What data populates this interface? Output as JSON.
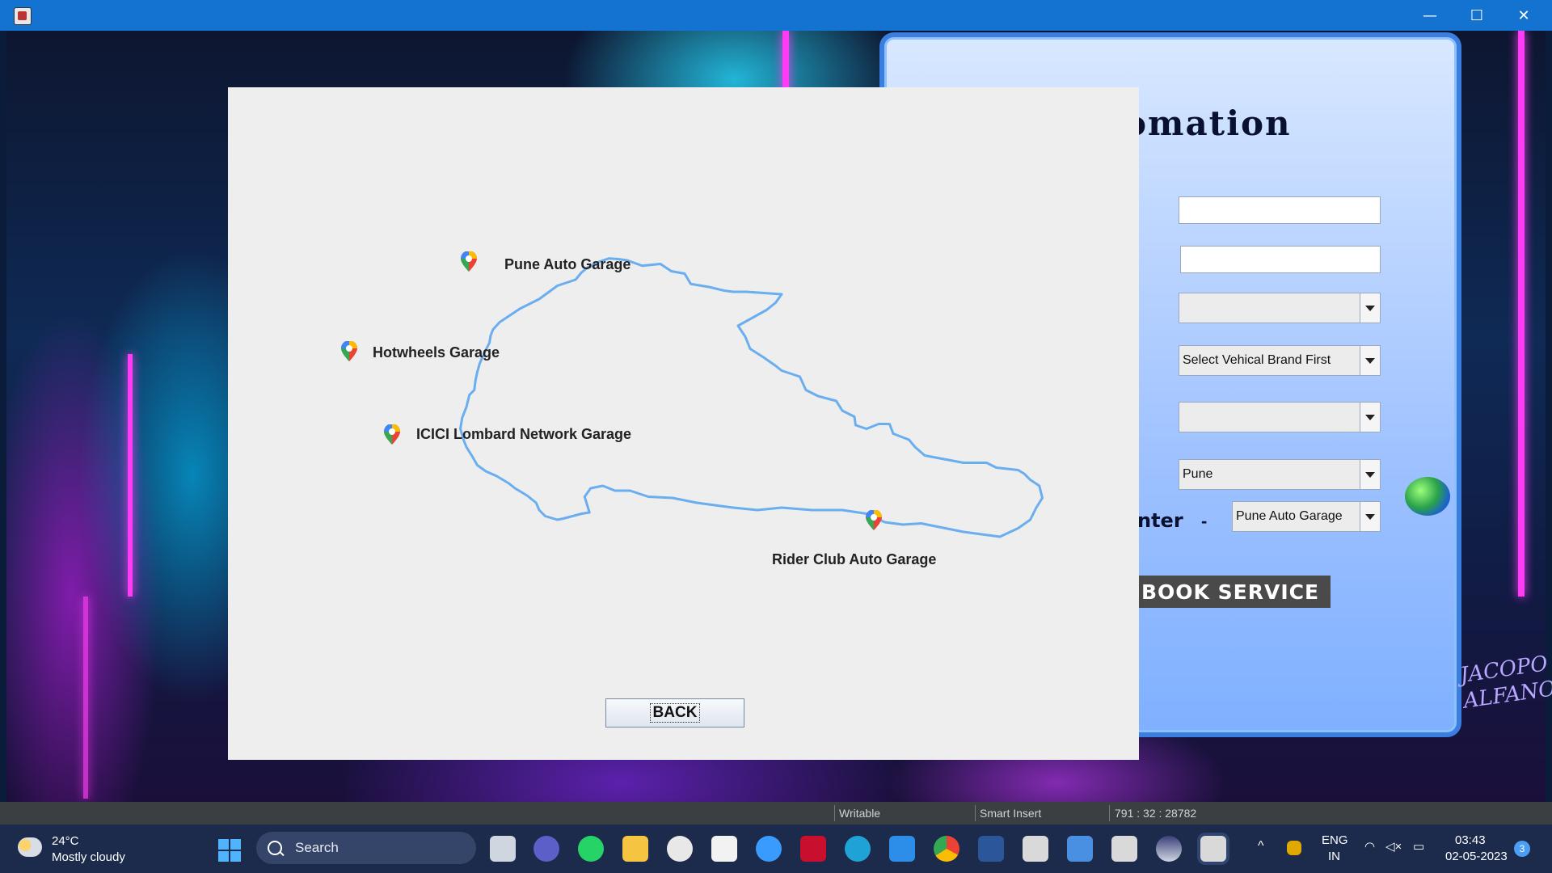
{
  "window": {
    "minimize": "—",
    "maximize": "☐",
    "close": "✕"
  },
  "panel": {
    "title_fragment": "omation",
    "vehicle_model_combo": "Select Vehical Brand First",
    "city_combo": "Pune",
    "center_label_fragment": "nter",
    "center_dash": "-",
    "center_combo": "Pune Auto Garage",
    "book_button": "BOOK SERVICE",
    "signature": [
      "JACOPO",
      "ALFANO"
    ]
  },
  "map_dialog": {
    "garages": [
      {
        "name": "Pune Auto Garage"
      },
      {
        "name": "Hotwheels Garage"
      },
      {
        "name": "ICICI Lombard Network Garage"
      },
      {
        "name": "Rider Club Auto Garage"
      }
    ],
    "back_button": "BACK"
  },
  "statusbar": {
    "mode": "Writable",
    "insert": "Smart Insert",
    "position": "791 : 32 : 28782"
  },
  "taskbar": {
    "weather_temp": "24°C",
    "weather_desc": "Mostly cloudy",
    "search_label": "Search",
    "lang_top": "ENG",
    "lang_bottom": "IN",
    "time": "03:43",
    "date": "02-05-2023",
    "notification_count": "3"
  },
  "colors": {
    "titlebar": "#1473d0",
    "map_outline": "#6aaef0",
    "taskbar": "#1c2b4b"
  }
}
